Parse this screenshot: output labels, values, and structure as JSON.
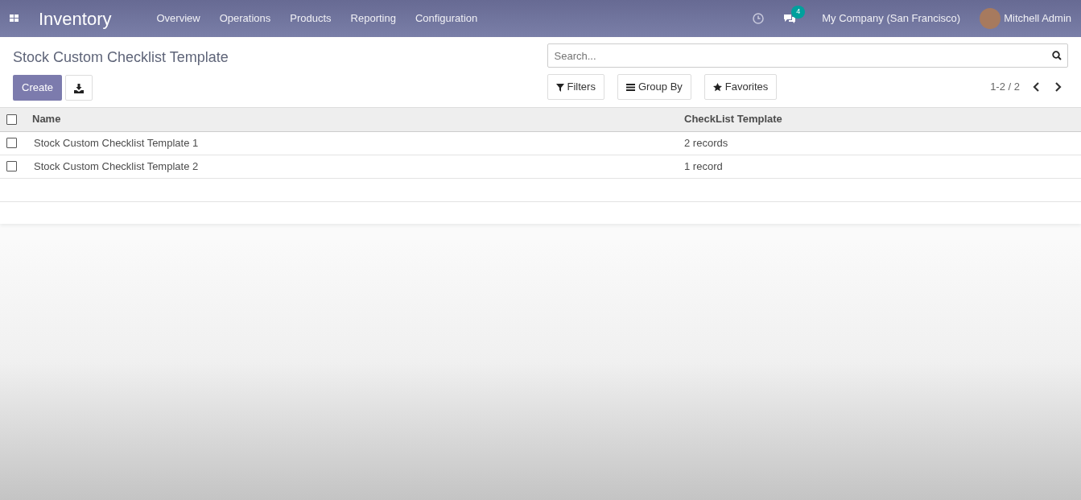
{
  "navbar": {
    "app_title": "Inventory",
    "menu": [
      "Overview",
      "Operations",
      "Products",
      "Reporting",
      "Configuration"
    ],
    "messages_count": "4",
    "company": "My Company (San Francisco)",
    "user": "Mitchell Admin"
  },
  "control_panel": {
    "title": "Stock Custom Checklist Template",
    "create_label": "Create",
    "search": {
      "placeholder": "Search..."
    },
    "filters": [
      {
        "kind": "filter",
        "label": "Filters"
      },
      {
        "kind": "group",
        "label": "Group By"
      },
      {
        "kind": "star",
        "label": "Favorites"
      }
    ],
    "pager": "1-2 / 2"
  },
  "table": {
    "all_checked": false,
    "columns": [
      "Name",
      "CheckList Template"
    ],
    "rows": [
      {
        "checked": false,
        "cells": [
          "Stock Custom Checklist Template 1",
          "2 records"
        ]
      },
      {
        "checked": false,
        "cells": [
          "Stock Custom Checklist Template 2",
          "1 record"
        ]
      }
    ]
  }
}
